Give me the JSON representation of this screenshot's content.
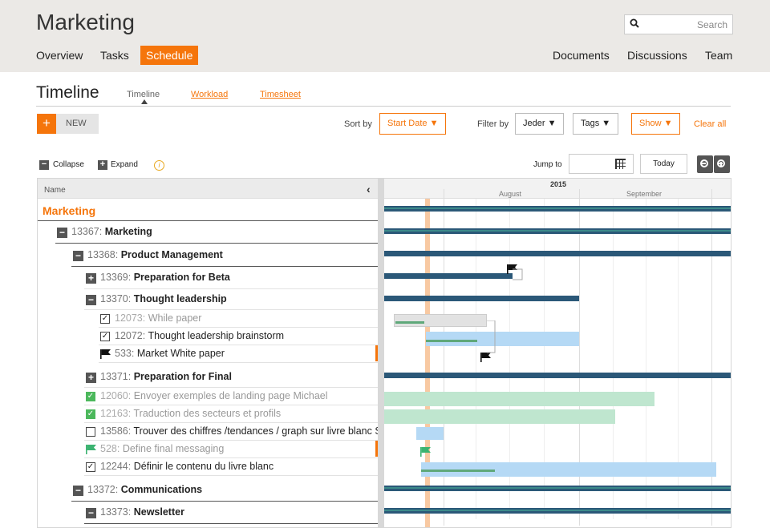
{
  "app": {
    "title": "Marketing"
  },
  "search": {
    "placeholder": "Search"
  },
  "nav": {
    "left": [
      {
        "label": "Overview"
      },
      {
        "label": "Tasks"
      },
      {
        "label": "Schedule",
        "active": true
      }
    ],
    "right": [
      {
        "label": "Documents"
      },
      {
        "label": "Discussions"
      },
      {
        "label": "Team"
      }
    ]
  },
  "page": {
    "title": "Timeline",
    "subtabs": [
      {
        "label": "Timeline",
        "current": true
      },
      {
        "label": "Workload"
      },
      {
        "label": "Timesheet"
      }
    ]
  },
  "toolbar": {
    "new_plus": "+",
    "new_label": "NEW",
    "sort_label": "Sort by",
    "sort_value": "Start Date ▼",
    "filter_label": "Filter by",
    "filter_jeder": "Jeder ▼",
    "filter_tags": "Tags ▼",
    "filter_show": "Show ▼",
    "clear_all": "Clear all"
  },
  "tree_tools": {
    "collapse": "Collapse",
    "expand": "Expand",
    "collapse_sym": "−",
    "expand_sym": "+",
    "info": "i"
  },
  "timeline_tools": {
    "jump_to": "Jump to",
    "today": "Today"
  },
  "grid": {
    "name_header": "Name",
    "collapse_arrow": "‹"
  },
  "timescale": {
    "year": "2015",
    "months": [
      "August",
      "September"
    ]
  },
  "rows": [
    {
      "id": "",
      "name": "Marketing"
    },
    {
      "id": "13367:",
      "name": "Marketing",
      "toggle": "−"
    },
    {
      "id": "13368:",
      "name": "Product Management",
      "toggle": "−"
    },
    {
      "id": "13369:",
      "name": "Preparation for Beta",
      "toggle": "+"
    },
    {
      "id": "13370:",
      "name": "Thought leadership",
      "toggle": "−"
    },
    {
      "id": "12073:",
      "name": "While paper",
      "check": "✓"
    },
    {
      "id": "12072:",
      "name": "Thought leadership brainstorm",
      "check": "✓"
    },
    {
      "id": "533:",
      "name": "Market White paper",
      "icon": "flag-black"
    },
    {
      "id": "13371:",
      "name": "Preparation for Final",
      "toggle": "+"
    },
    {
      "id": "12060:",
      "name": "Envoyer exemples de landing page Michael",
      "check": "✓"
    },
    {
      "id": "12163:",
      "name": "Traduction des secteurs et profils",
      "check": "✓"
    },
    {
      "id": "13586:",
      "name": "Trouver des chiffres /tendances / graph sur livre blanc SaaS Gur",
      "check": ""
    },
    {
      "id": "528:",
      "name": "Define final messaging",
      "icon": "flag-green"
    },
    {
      "id": "12244:",
      "name": "Définir le contenu du livre blanc",
      "check": "✓"
    },
    {
      "id": "13372:",
      "name": "Communications",
      "toggle": "−"
    },
    {
      "id": "13373:",
      "name": "Newsletter",
      "toggle": "−"
    }
  ],
  "colors": {
    "accent": "#f5750b",
    "summary_bar": "#2b5878",
    "task_bar": "#b5d9f5",
    "done_bar": "#bfe6cf",
    "gray_bar": "#e2e2e2",
    "progress": "#5fa87a",
    "today": "#f8c9a2"
  }
}
